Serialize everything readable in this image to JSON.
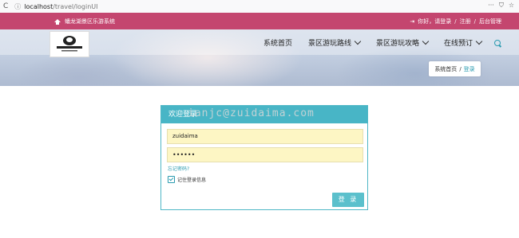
{
  "browser": {
    "url_host": "localhost",
    "url_path": "/travel/loginUI",
    "menu_icon": "ellipsis-icon",
    "icons": [
      "info-icon",
      "ellipsis-icon",
      "pocket-icon",
      "star-icon"
    ]
  },
  "topbar": {
    "site_name": "蟠龙湖景区乐游系统",
    "greeting": "你好，请登录",
    "register": "注册",
    "admin": "后台管理",
    "sep1": "/",
    "sep2": "/",
    "color": "#c4466f"
  },
  "nav": {
    "items": [
      "系统首页",
      "景区游玩路线",
      "景区游玩攻略",
      "在线预订"
    ]
  },
  "breadcrumb": {
    "home": "系统首页",
    "sep": "/",
    "current": "登录"
  },
  "login": {
    "title": "欢迎登录",
    "watermark": "ianjc@zuidaima.com",
    "username": "zuidaima",
    "password": "••••••",
    "forgot": "忘记密码?",
    "remember": "记住登录信息",
    "submit": "登 录",
    "accent": "#48b5c6"
  }
}
